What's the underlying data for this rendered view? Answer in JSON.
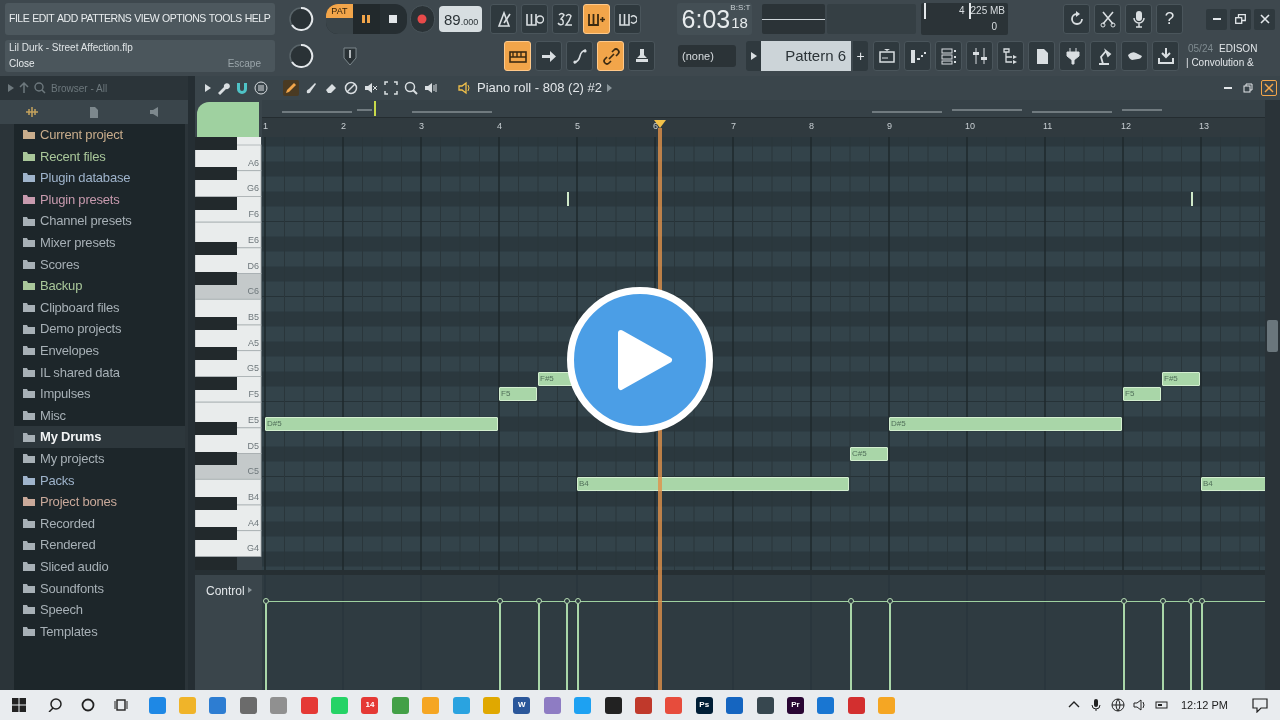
{
  "menu": [
    "FILE",
    "EDIT",
    "ADD",
    "PATTERNS",
    "VIEW",
    "OPTIONS",
    "TOOLS",
    "HELP"
  ],
  "hint": {
    "title": "Lil Durk - Street Affection.flp",
    "action": "Close",
    "shortcut": "Escape"
  },
  "transport": {
    "mode_label": "PAT",
    "pattern_mode": true,
    "playing": true
  },
  "master_volume": {
    "level": 0.1
  },
  "tempo": {
    "whole": "89",
    "fraction": ".000"
  },
  "time": {
    "main": "6:03",
    "ticks": "18",
    "label": "B:S:T"
  },
  "meter": {
    "count": "4",
    "memory": "225 MB",
    "polyphony": "0"
  },
  "toggles_top": [
    {
      "kind": "metronome",
      "active": false
    },
    {
      "kind": "wait",
      "active": false
    },
    {
      "kind": "countdown",
      "active": false
    },
    {
      "kind": "step",
      "active": true
    },
    {
      "kind": "loop-record",
      "active": false
    }
  ],
  "toggles_bottom": [
    {
      "kind": "typing-keyboard",
      "active": true
    },
    {
      "kind": "arrow",
      "active": false
    },
    {
      "kind": "blend",
      "active": false
    },
    {
      "kind": "link",
      "active": true
    },
    {
      "kind": "stamp",
      "active": false
    }
  ],
  "help_label": "?",
  "pattern": {
    "snap": "(none)",
    "name": "Pattern 6",
    "add": "+"
  },
  "plugin": {
    "counter": "05/24",
    "name": "EDISON",
    "subtitle": "| Convolution &"
  },
  "browser": {
    "title": "Browser - All",
    "items": [
      {
        "label": "Current project",
        "color": "#c9ad8c",
        "selected": false
      },
      {
        "label": "Recent files",
        "color": "#a9c79a",
        "selected": false
      },
      {
        "label": "Plugin database",
        "color": "#9fb4cc",
        "selected": false
      },
      {
        "label": "Plugin presets",
        "color": "#c79aae",
        "selected": false
      },
      {
        "label": "Channel presets",
        "color": "#a7b0b6",
        "selected": false
      },
      {
        "label": "Mixer presets",
        "color": "#a7b0b6",
        "selected": false
      },
      {
        "label": "Scores",
        "color": "#a7b0b6",
        "selected": false
      },
      {
        "label": "Backup",
        "color": "#a9c79a",
        "selected": false
      },
      {
        "label": "Clipboard files",
        "color": "#a7b0b6",
        "selected": false
      },
      {
        "label": "Demo projects",
        "color": "#a7b0b6",
        "selected": false
      },
      {
        "label": "Envelopes",
        "color": "#a7b0b6",
        "selected": false
      },
      {
        "label": "IL shared data",
        "color": "#a7b0b6",
        "selected": false
      },
      {
        "label": "Impulses",
        "color": "#a7b0b6",
        "selected": false
      },
      {
        "label": "Misc",
        "color": "#a7b0b6",
        "selected": false
      },
      {
        "label": "My Drums",
        "color": "#a7b0b6",
        "selected": true
      },
      {
        "label": "My projects",
        "color": "#a7b0b6",
        "selected": false
      },
      {
        "label": "Packs",
        "color": "#9fb4cc",
        "selected": false
      },
      {
        "label": "Project bones",
        "color": "#c9a99a",
        "selected": false
      },
      {
        "label": "Recorded",
        "color": "#a7b0b6",
        "selected": false
      },
      {
        "label": "Rendered",
        "color": "#a7b0b6",
        "selected": false
      },
      {
        "label": "Sliced audio",
        "color": "#a7b0b6",
        "selected": false
      },
      {
        "label": "Soundfonts",
        "color": "#a7b0b6",
        "selected": false
      },
      {
        "label": "Speech",
        "color": "#a7b0b6",
        "selected": false
      },
      {
        "label": "Templates",
        "color": "#a7b0b6",
        "selected": false
      }
    ]
  },
  "piano_roll": {
    "title": "Piano roll - 808 (2) #2",
    "tools": [
      {
        "kind": "pencil",
        "selected": true
      },
      {
        "kind": "brush",
        "selected": false
      },
      {
        "kind": "delete",
        "selected": false
      },
      {
        "kind": "mute",
        "selected": false
      },
      {
        "kind": "slice",
        "selected": false
      },
      {
        "kind": "select",
        "selected": false
      },
      {
        "kind": "zoom",
        "selected": false
      },
      {
        "kind": "playback",
        "selected": false
      }
    ],
    "ruler": [
      "1",
      "2",
      "3",
      "4",
      "5",
      "6",
      "7",
      "8",
      "9",
      "10",
      "11",
      "12",
      "13"
    ],
    "keys": [
      {
        "label": "A6",
        "shaded": false
      },
      {
        "label": "G6",
        "shaded": false
      },
      {
        "label": "F6",
        "shaded": false
      },
      {
        "label": "E6",
        "shaded": false
      },
      {
        "label": "D6",
        "shaded": false
      },
      {
        "label": "C6",
        "shaded": true
      },
      {
        "label": "B5",
        "shaded": false
      },
      {
        "label": "A5",
        "shaded": false
      },
      {
        "label": "G5",
        "shaded": false
      },
      {
        "label": "F5",
        "shaded": false
      },
      {
        "label": "E5",
        "shaded": false
      },
      {
        "label": "D5",
        "shaded": false
      },
      {
        "label": "C5",
        "shaded": true
      },
      {
        "label": "B4",
        "shaded": false
      },
      {
        "label": "A4",
        "shaded": false
      },
      {
        "label": "G4",
        "shaded": false
      }
    ],
    "notes": [
      {
        "label": "D#5"
      },
      {
        "label": "F5"
      },
      {
        "label": "F#5"
      },
      {
        "kind": "tick"
      },
      {
        "label": "B4"
      },
      {
        "label": "C#5"
      },
      {
        "label": "D#5"
      },
      {
        "label": "F5"
      },
      {
        "label": "F#5"
      },
      {
        "kind": "tick"
      },
      {
        "label": "B4"
      }
    ],
    "control_label": "Control"
  },
  "taskbar": {
    "apps": [
      {
        "color": "#1e88e5"
      },
      {
        "color": "#f0b429"
      },
      {
        "color": "#2d7dd2"
      },
      {
        "color": "#6b6b6b"
      },
      {
        "color": "#909090"
      },
      {
        "color": "#e53935"
      },
      {
        "color": "#25d366"
      },
      {
        "color": "#e53935",
        "label": "14"
      },
      {
        "color": "#43a047"
      },
      {
        "color": "#f5a623"
      },
      {
        "color": "#2aa3e0"
      },
      {
        "color": "#e0a800"
      },
      {
        "color": "#2b579a",
        "label": "W"
      },
      {
        "color": "#8e7cc3"
      },
      {
        "color": "#1da1f2"
      },
      {
        "color": "#222222"
      },
      {
        "color": "#c0392b"
      },
      {
        "color": "#e74c3c"
      },
      {
        "color": "#001e36",
        "label": "Ps"
      },
      {
        "color": "#1565c0"
      },
      {
        "color": "#37474f"
      },
      {
        "color": "#2a0634",
        "label": "Pr"
      },
      {
        "color": "#1976d2"
      },
      {
        "color": "#d32f2f"
      },
      {
        "color": "#f5a623"
      }
    ],
    "clock": "12:12 PM"
  }
}
